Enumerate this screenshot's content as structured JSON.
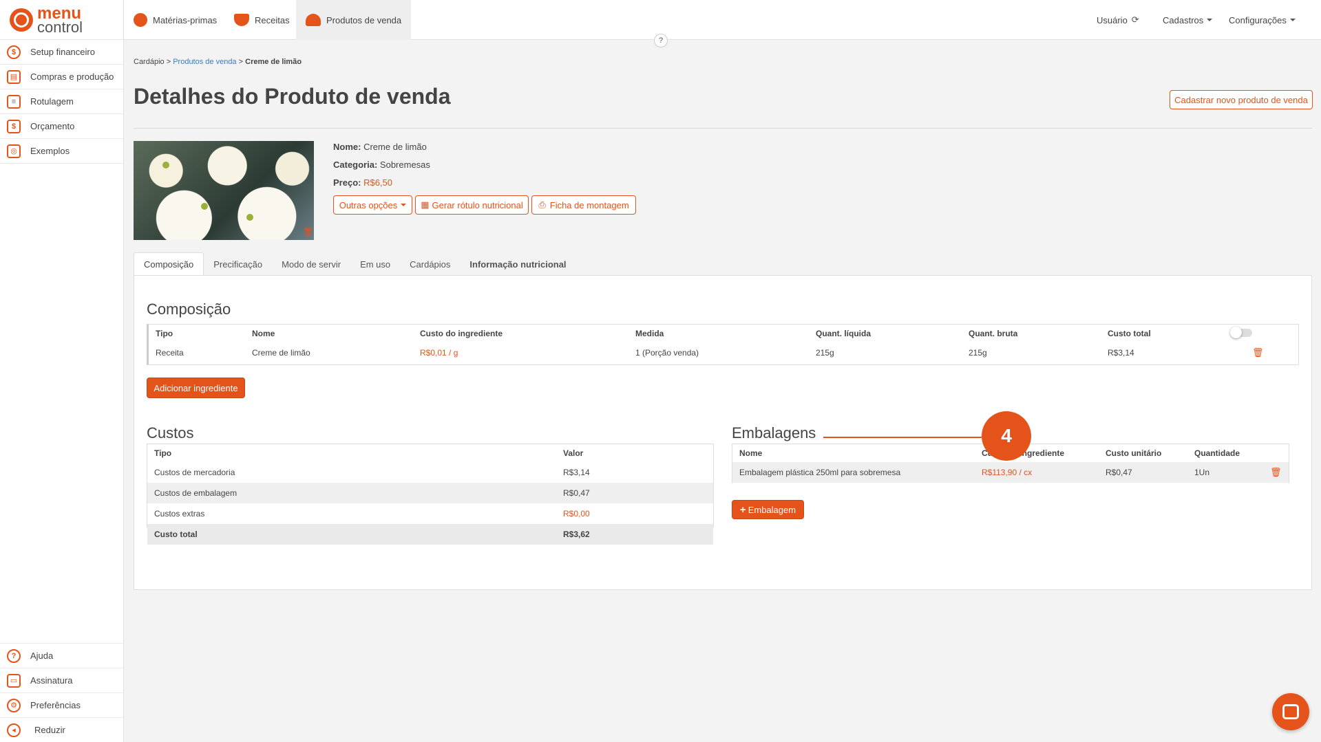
{
  "brand": {
    "line1": "menu",
    "line2": "control",
    "accent": "#e4531a"
  },
  "sidebar": {
    "items": [
      {
        "label": "Setup financeiro",
        "icon": "dollar-gear-icon"
      },
      {
        "label": "Compras e produção",
        "icon": "cart-clipboard-icon"
      },
      {
        "label": "Rotulagem",
        "icon": "label-icon"
      },
      {
        "label": "Orçamento",
        "icon": "budget-icon"
      },
      {
        "label": "Exemplos",
        "icon": "lightbulb-icon"
      }
    ],
    "bottom": [
      {
        "label": "Ajuda",
        "icon": "help-icon"
      },
      {
        "label": "Assinatura",
        "icon": "card-icon"
      },
      {
        "label": "Preferências",
        "icon": "gear-icon"
      },
      {
        "label": "Reduzir",
        "icon": "collapse-icon"
      }
    ]
  },
  "topnav": {
    "tabs": [
      {
        "label": "Matérias-primas",
        "icon": "tomato-icon"
      },
      {
        "label": "Receitas",
        "icon": "bowl-icon"
      },
      {
        "label": "Produtos de venda",
        "icon": "cloche-icon"
      }
    ],
    "right": {
      "user": "Usuário",
      "cadastros": "Cadastros",
      "config": "Configurações"
    },
    "help": "?"
  },
  "breadcrumb": {
    "root": "Cardápio",
    "sep": ">",
    "section": "Produtos de venda",
    "current": "Creme de limão"
  },
  "page": {
    "title": "Detalhes do Produto de venda",
    "new_button": "Cadastrar novo produto de venda"
  },
  "product": {
    "name_label": "Nome:",
    "name": "Creme de limão",
    "category_label": "Categoria:",
    "category": "Sobremesas",
    "price_label": "Preço:",
    "price": "R$6,50",
    "actions": {
      "more": "Outras opções",
      "nutrition": "Gerar rótulo nutricional",
      "sheet": "Ficha de montagem"
    }
  },
  "tabs": [
    "Composição",
    "Precificação",
    "Modo de servir",
    "Em uso",
    "Cardápios",
    "Informação nutricional"
  ],
  "composicao": {
    "title": "Composição",
    "headers": [
      "Tipo",
      "Nome",
      "Custo do ingrediente",
      "Medida",
      "Quant. líquida",
      "Quant. bruta",
      "Custo total"
    ],
    "rows": [
      [
        "Receita",
        "Creme de limão",
        "R$0,01 / g",
        "1 (Porção venda)",
        "215g",
        "215g",
        "R$3,14"
      ]
    ],
    "add_button": "Adicionar ingrediente"
  },
  "custos": {
    "title": "Custos",
    "headers": [
      "Tipo",
      "Valor"
    ],
    "rows": [
      [
        "Custos de mercadoria",
        "R$3,14"
      ],
      [
        "Custos de embalagem",
        "R$0,47"
      ],
      [
        "Custos extras",
        "R$0,00"
      ],
      [
        "Custo total",
        "R$3,62"
      ]
    ]
  },
  "embalagens": {
    "title": "Embalagens",
    "headers": [
      "Nome",
      "Custo do ingrediente",
      "Custo unitário",
      "Quantidade"
    ],
    "rows": [
      [
        "Embalagem plástica 250ml para sobremesa",
        "R$113,90 / cx",
        "R$0,47",
        "1Un"
      ]
    ],
    "add_button": "Embalagem"
  },
  "step_badge": "4"
}
